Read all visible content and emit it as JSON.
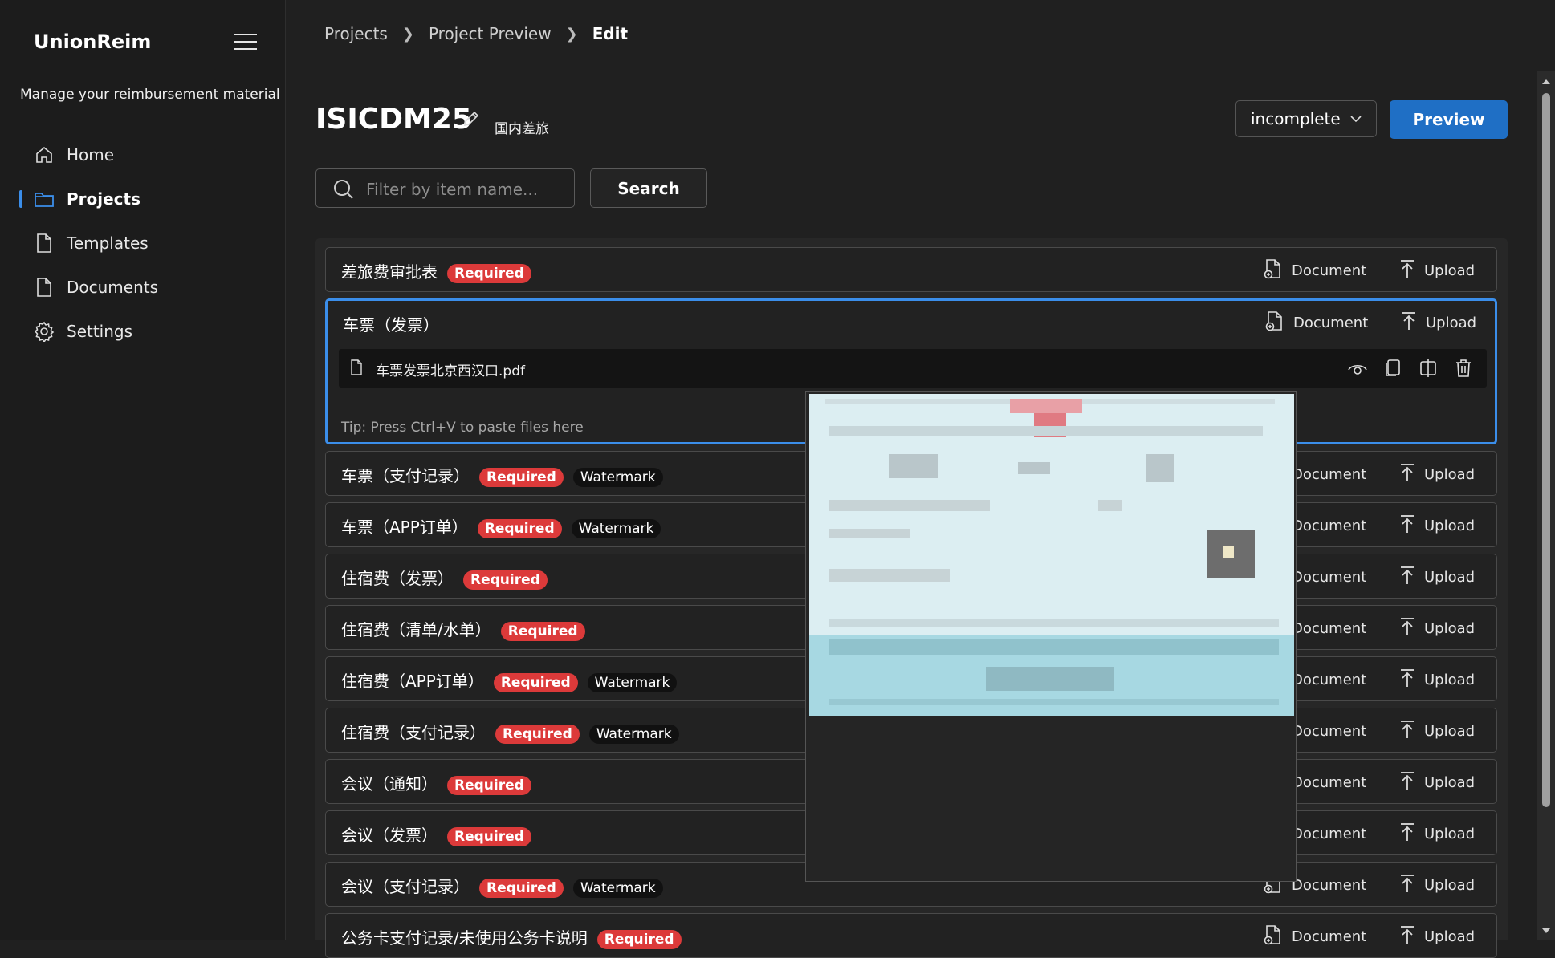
{
  "sidebar": {
    "app_title": "UnionReim",
    "subtitle": "Manage your reimbursement material",
    "items": [
      {
        "label": "Home",
        "icon": "home-icon",
        "active": false
      },
      {
        "label": "Projects",
        "icon": "folder-icon",
        "active": true
      },
      {
        "label": "Templates",
        "icon": "document-icon",
        "active": false
      },
      {
        "label": "Documents",
        "icon": "document-icon",
        "active": false
      },
      {
        "label": "Settings",
        "icon": "gear-icon",
        "active": false
      }
    ]
  },
  "breadcrumb": {
    "items": [
      "Projects",
      "Project Preview",
      "Edit"
    ]
  },
  "project": {
    "title": "ISICDM25",
    "tag": "国内差旅",
    "status": "incomplete",
    "preview_label": "Preview"
  },
  "search": {
    "placeholder": "Filter by item name...",
    "button_label": "Search"
  },
  "actions": {
    "document_label": "Document",
    "upload_label": "Upload"
  },
  "badges": {
    "required": "Required",
    "watermark": "Watermark"
  },
  "items": [
    {
      "name": "差旅费审批表",
      "required": true,
      "watermark": false
    },
    {
      "name": "车票（发票）",
      "required": false,
      "watermark": false,
      "expanded": true,
      "file": "车票发票北京西汉口.pdf",
      "tip": "Tip: Press Ctrl+V to paste files here"
    },
    {
      "name": "车票（支付记录）",
      "required": true,
      "watermark": true
    },
    {
      "name": "车票（APP订单）",
      "required": true,
      "watermark": true
    },
    {
      "name": "住宿费（发票）",
      "required": true,
      "watermark": false
    },
    {
      "name": "住宿费（清单/水单）",
      "required": true,
      "watermark": false
    },
    {
      "name": "住宿费（APP订单）",
      "required": true,
      "watermark": true
    },
    {
      "name": "住宿费（支付记录）",
      "required": true,
      "watermark": true
    },
    {
      "name": "会议（通知）",
      "required": true,
      "watermark": false
    },
    {
      "name": "会议（发票）",
      "required": true,
      "watermark": false
    },
    {
      "name": "会议（支付记录）",
      "required": true,
      "watermark": true
    },
    {
      "name": "公务卡支付记录/未使用公务卡说明",
      "required": true,
      "watermark": false
    }
  ],
  "colors": {
    "accent": "#3b8eea",
    "primary_button": "#1f6fc5",
    "required_badge": "#dc3a3a",
    "watermark_badge": "#111111"
  }
}
